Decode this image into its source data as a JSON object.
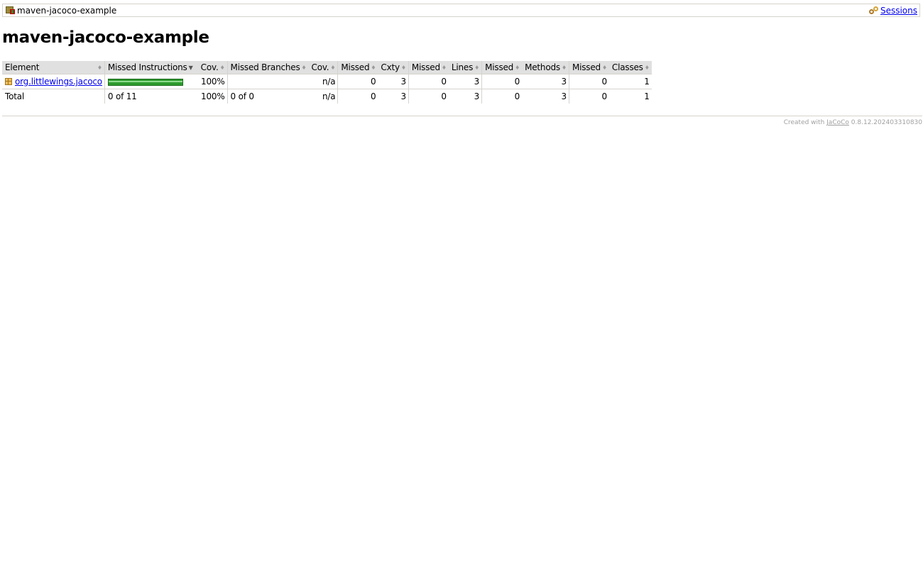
{
  "breadcrumb": {
    "report_name": "maven-jacoco-example",
    "sessions_label": "Sessions"
  },
  "page_title": "maven-jacoco-example",
  "table": {
    "headers": [
      "Element",
      "Missed Instructions",
      "Cov.",
      "Missed Branches",
      "Cov.",
      "Missed",
      "Cxty",
      "Missed",
      "Lines",
      "Missed",
      "Methods",
      "Missed",
      "Classes"
    ],
    "rows": [
      {
        "element": "org.littlewings.jacoco",
        "instruction_coverage_fraction": 1.0,
        "instr_cov": "100%",
        "branches": "",
        "branch_cov": "n/a",
        "missed_cxty": "0",
        "cxty": "3",
        "missed_lines": "0",
        "lines": "3",
        "missed_methods": "0",
        "methods": "3",
        "missed_classes": "0",
        "classes": "1"
      }
    ],
    "total": {
      "label": "Total",
      "instructions": "0 of 11",
      "instr_cov": "100%",
      "branches": "0 of 0",
      "branch_cov": "n/a",
      "missed_cxty": "0",
      "cxty": "3",
      "missed_lines": "0",
      "lines": "3",
      "missed_methods": "0",
      "methods": "3",
      "missed_classes": "0",
      "classes": "1"
    }
  },
  "footer": {
    "prefix": "Created with",
    "tool": "JaCoCo",
    "version": "0.8.12.202403310830"
  },
  "colors": {
    "coverage_bar": "#2e9b2e",
    "header_bg": "#e0e0e0",
    "link": "#0000ee"
  }
}
